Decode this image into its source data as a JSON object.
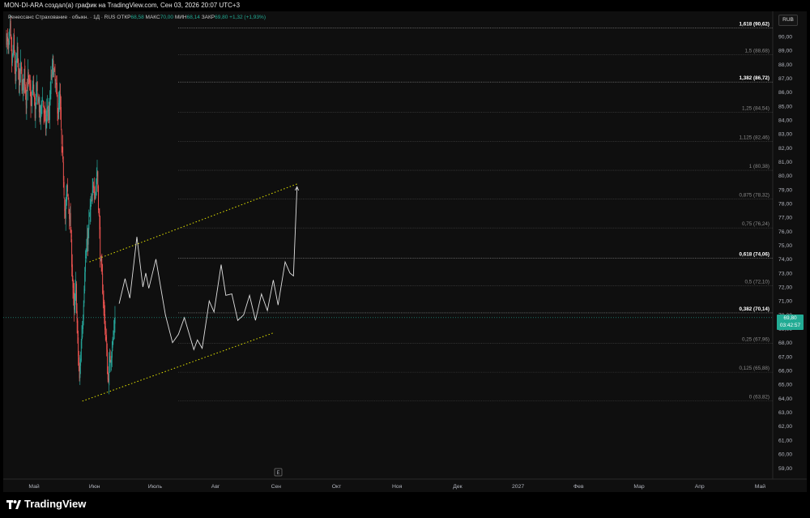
{
  "header": {
    "attribution": "MON-DI-ARA создал(а) график на TradingView.com, Сен 03, 2026 20:07 UTC+3"
  },
  "legend": {
    "symbol": "Ренессанс Страхование · обыкн. · 1Д · RUS",
    "open_label": "ОТКР",
    "open_value": "68,58",
    "high_label": "МАКС",
    "high_value": "70,00",
    "low_label": "МИН",
    "low_value": "68,14",
    "close_label": "ЗАКР",
    "close_value": "69,80",
    "change": "+1,32 (+1,93%)"
  },
  "currency_button": "RUB",
  "last_price": {
    "price": "69,80",
    "countdown": "03:42:57"
  },
  "branding": {
    "logo_text": "TradingView"
  },
  "colors": {
    "up": "#26a69a",
    "down": "#ef5350",
    "fib_line": "#7f7f7f",
    "channel": "#e5e500",
    "projection": "#e0e0e0",
    "price_tag": "#22ab94"
  },
  "chart_data": {
    "type": "candlestick",
    "ylim": [
      58.2,
      91.8
    ],
    "x_axis_labels": [
      "Май",
      "Июн",
      "Июль",
      "Авг",
      "Сен",
      "Окт",
      "Ноя",
      "Дек",
      "2027",
      "Фев",
      "Мар",
      "Апр",
      "Май"
    ],
    "y_ticks": [
      "59,00",
      "60,00",
      "61,00",
      "62,00",
      "63,00",
      "64,00",
      "65,00",
      "66,00",
      "67,00",
      "68,00",
      "69,00",
      "70,00",
      "71,00",
      "72,00",
      "73,00",
      "74,00",
      "75,00",
      "76,00",
      "77,00",
      "78,00",
      "79,00",
      "80,00",
      "81,00",
      "82,00",
      "83,00",
      "84,00",
      "85,00",
      "86,00",
      "87,00",
      "88,00",
      "89,00",
      "90,00"
    ],
    "fib_levels": [
      {
        "label": "1,618 (90,62)",
        "value": 90.62,
        "major": true
      },
      {
        "label": "1,5 (88,68)",
        "value": 88.68,
        "major": false
      },
      {
        "label": "1,382 (86,72)",
        "value": 86.72,
        "major": true
      },
      {
        "label": "1,25 (84,54)",
        "value": 84.54,
        "major": false
      },
      {
        "label": "1,125 (82,46)",
        "value": 82.46,
        "major": false
      },
      {
        "label": "1 (80,38)",
        "value": 80.38,
        "major": false
      },
      {
        "label": "0,875 (78,32)",
        "value": 78.32,
        "major": false
      },
      {
        "label": "0,75 (76,24)",
        "value": 76.24,
        "major": false
      },
      {
        "label": "0,618 (74,06)",
        "value": 74.06,
        "major": true
      },
      {
        "label": "0,5 (72,10)",
        "value": 72.1,
        "major": false
      },
      {
        "label": "0,382 (70,14)",
        "value": 70.14,
        "major": true
      },
      {
        "label": "0,25 (67,96)",
        "value": 67.96,
        "major": false
      },
      {
        "label": "0,125 (65,88)",
        "value": 65.88,
        "major": false
      },
      {
        "label": "0 (63,82)",
        "value": 63.82,
        "major": false
      }
    ],
    "last_close": 69.8,
    "ohlc_path": [
      [
        0,
        90.0
      ],
      [
        3,
        89.0
      ],
      [
        6,
        90.4
      ],
      [
        9,
        88.0
      ],
      [
        12,
        89.4
      ],
      [
        15,
        87.0
      ],
      [
        18,
        88.8
      ],
      [
        21,
        86.5
      ],
      [
        24,
        87.8
      ],
      [
        27,
        86.0
      ],
      [
        30,
        87.5
      ],
      [
        33,
        85.6
      ],
      [
        36,
        87.0
      ],
      [
        39,
        86.2
      ],
      [
        42,
        85.0
      ],
      [
        45,
        86.6
      ],
      [
        48,
        84.5
      ],
      [
        51,
        86.0
      ],
      [
        54,
        85.4
      ],
      [
        57,
        84.0
      ],
      [
        60,
        85.8
      ],
      [
        63,
        84.6
      ],
      [
        66,
        83.5
      ],
      [
        69,
        85.0
      ],
      [
        72,
        84.2
      ],
      [
        75,
        86.8
      ],
      [
        78,
        88.0
      ],
      [
        81,
        87.0
      ],
      [
        84,
        86.0
      ],
      [
        87,
        84.5
      ],
      [
        90,
        85.5
      ],
      [
        93,
        82.0
      ],
      [
        96,
        80.0
      ],
      [
        99,
        77.0
      ],
      [
        102,
        79.0
      ],
      [
        105,
        78.0
      ],
      [
        108,
        76.0
      ],
      [
        111,
        73.0
      ],
      [
        114,
        70.0
      ],
      [
        117,
        72.0
      ],
      [
        120,
        68.0
      ],
      [
        123,
        65.2
      ],
      [
        126,
        68.0
      ],
      [
        129,
        70.0
      ],
      [
        132,
        73.5
      ],
      [
        135,
        74.5
      ],
      [
        138,
        76.0
      ],
      [
        141,
        77.5
      ],
      [
        144,
        78.0
      ],
      [
        147,
        79.5
      ],
      [
        150,
        79.0
      ],
      [
        153,
        80.3
      ],
      [
        156,
        77.0
      ],
      [
        159,
        73.5
      ],
      [
        162,
        72.0
      ],
      [
        165,
        70.0
      ],
      [
        168,
        68.0
      ],
      [
        171,
        65.3
      ],
      [
        174,
        66.5
      ],
      [
        177,
        67.5
      ],
      [
        180,
        68.3
      ],
      [
        183,
        69.8
      ]
    ],
    "projection_path": [
      [
        190,
        70.8
      ],
      [
        200,
        72.6
      ],
      [
        208,
        71.2
      ],
      [
        220,
        75.6
      ],
      [
        230,
        72.0
      ],
      [
        235,
        73.0
      ],
      [
        240,
        71.9
      ],
      [
        252,
        74.0
      ],
      [
        268,
        70.0
      ],
      [
        280,
        68.0
      ],
      [
        290,
        68.6
      ],
      [
        300,
        69.8
      ],
      [
        316,
        67.5
      ],
      [
        322,
        68.2
      ],
      [
        330,
        67.6
      ],
      [
        342,
        71.0
      ],
      [
        350,
        70.2
      ],
      [
        362,
        73.6
      ],
      [
        370,
        71.4
      ],
      [
        380,
        71.5
      ],
      [
        390,
        69.6
      ],
      [
        400,
        70.0
      ],
      [
        410,
        71.4
      ],
      [
        420,
        69.6
      ],
      [
        430,
        71.5
      ],
      [
        440,
        70.3
      ],
      [
        450,
        72.5
      ],
      [
        458,
        70.7
      ],
      [
        470,
        73.8
      ],
      [
        478,
        73.0
      ],
      [
        484,
        72.8
      ],
      [
        490,
        79.2
      ]
    ],
    "channel_upper": [
      [
        140,
        73.8
      ],
      [
        490,
        79.4
      ]
    ],
    "channel_lower": [
      [
        128,
        63.8
      ],
      [
        450,
        68.7
      ]
    ]
  }
}
